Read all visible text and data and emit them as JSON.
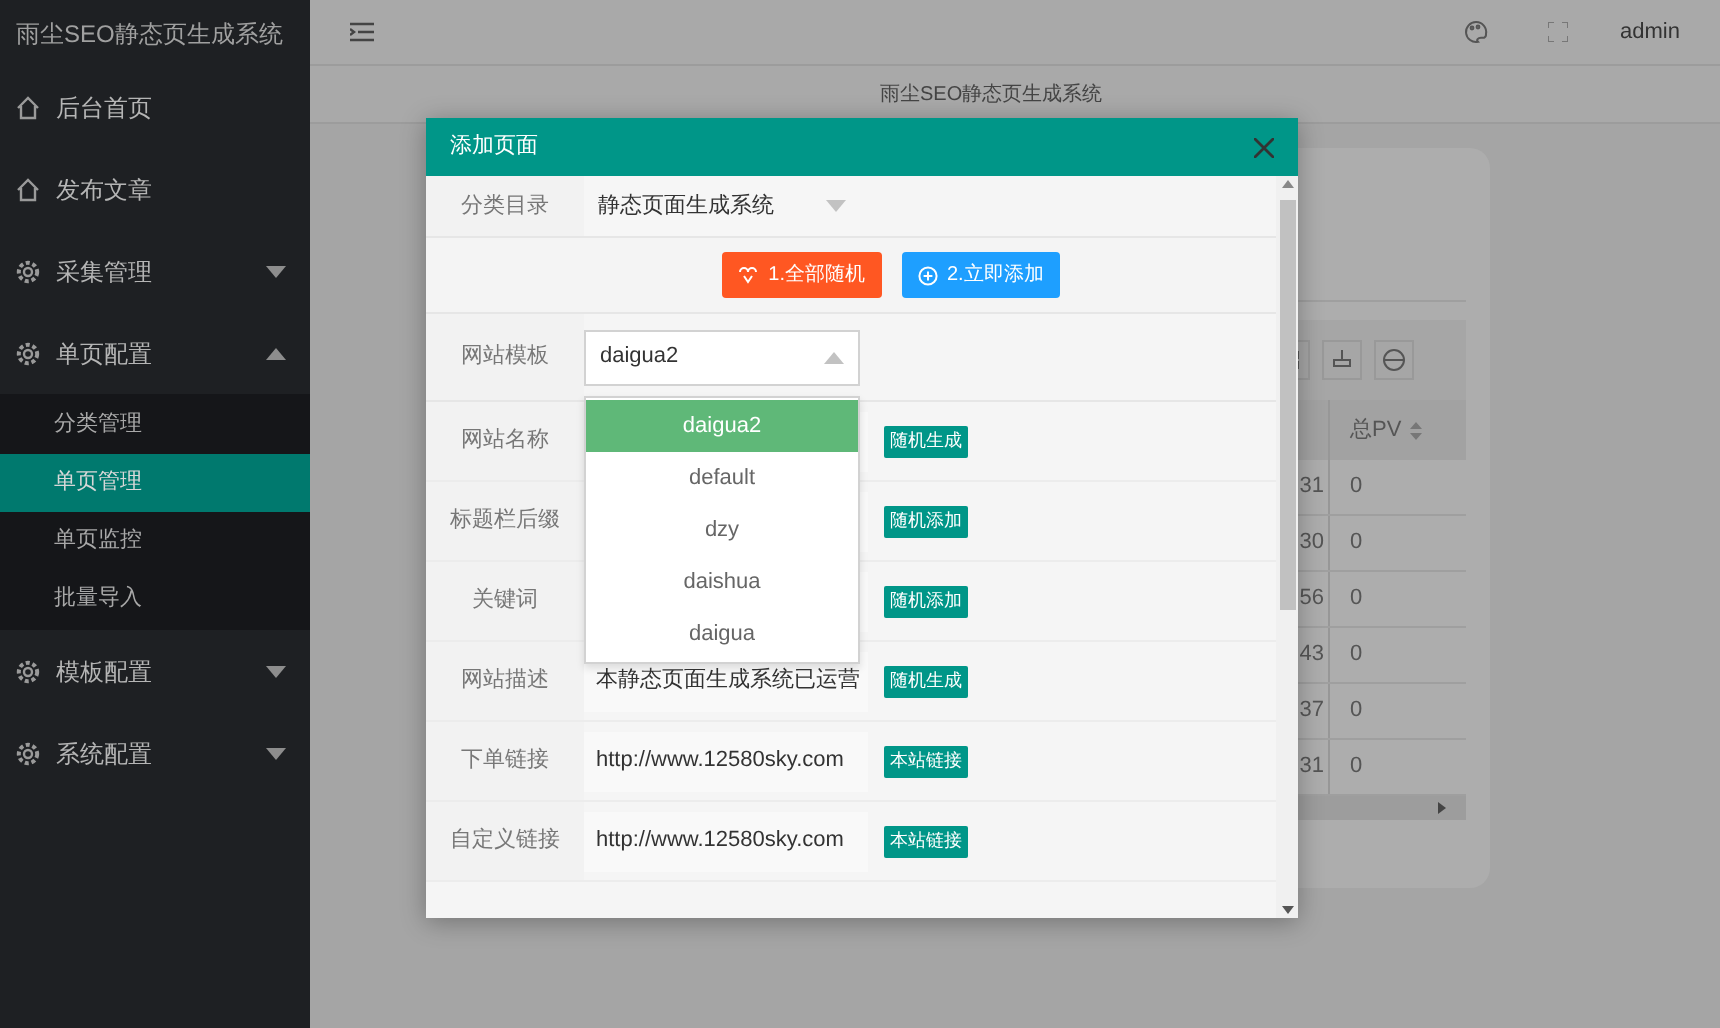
{
  "app_title": "雨尘SEO静态页生成系统",
  "header": {
    "user": "admin"
  },
  "breadcrumb": "雨尘SEO静态页生成系统",
  "sidebar": {
    "items": [
      {
        "kind": "link",
        "label": "后台首页"
      },
      {
        "kind": "link",
        "label": "发布文章"
      },
      {
        "kind": "group",
        "label": "采集管理",
        "expanded": false
      },
      {
        "kind": "group",
        "label": "单页配置",
        "expanded": true,
        "children": [
          {
            "label": "分类管理",
            "selected": false
          },
          {
            "label": "单页管理",
            "selected": true
          },
          {
            "label": "单页监控",
            "selected": false
          },
          {
            "label": "批量导入",
            "selected": false
          }
        ]
      },
      {
        "kind": "group",
        "label": "模板配置",
        "expanded": false
      },
      {
        "kind": "group",
        "label": "系统配置",
        "expanded": false
      }
    ]
  },
  "background_table": {
    "header": "总PV",
    "rows": [
      {
        "column_1": "31",
        "column_2": "0"
      },
      {
        "column_1": "30",
        "column_2": "0"
      },
      {
        "column_1": "56",
        "column_2": "0"
      },
      {
        "column_1": "43",
        "column_2": "0"
      },
      {
        "column_1": "37",
        "column_2": "0"
      },
      {
        "column_1": "31",
        "column_2": "0"
      }
    ]
  },
  "modal": {
    "title": "添加页面",
    "rows": [
      {
        "kind": "select",
        "label": "分类目录",
        "value": "静态页面生成系统",
        "expanded": false
      },
      {
        "kind": "buttons",
        "buttons": [
          {
            "label": "1.全部随机",
            "color": "#ff5722"
          },
          {
            "label": "2.立即添加",
            "color": "#1e9fff"
          }
        ]
      },
      {
        "kind": "select",
        "label": "网站模板",
        "value": "daigua2",
        "expanded": true,
        "options": [
          {
            "label": "daigua2",
            "selected": true
          },
          {
            "label": "default",
            "selected": false
          },
          {
            "label": "dzy",
            "selected": false
          },
          {
            "label": "daishua",
            "selected": false
          },
          {
            "label": "daigua",
            "selected": false
          }
        ]
      },
      {
        "kind": "text",
        "label": "网站名称",
        "tag": "随机生成"
      },
      {
        "kind": "text",
        "label": "标题栏后缀",
        "tag": "随机添加"
      },
      {
        "kind": "text",
        "label": "关键词",
        "tag": "随机添加"
      },
      {
        "kind": "text",
        "label": "网站描述",
        "value": "本静态页面生成系统已运营",
        "tag": "随机生成"
      },
      {
        "kind": "text",
        "label": "下单链接",
        "value": "http://www.12580sky.com",
        "tag": "本站链接"
      },
      {
        "kind": "text",
        "label": "自定义链接",
        "value": "http://www.12580sky.com",
        "tag": "本站链接"
      }
    ]
  }
}
